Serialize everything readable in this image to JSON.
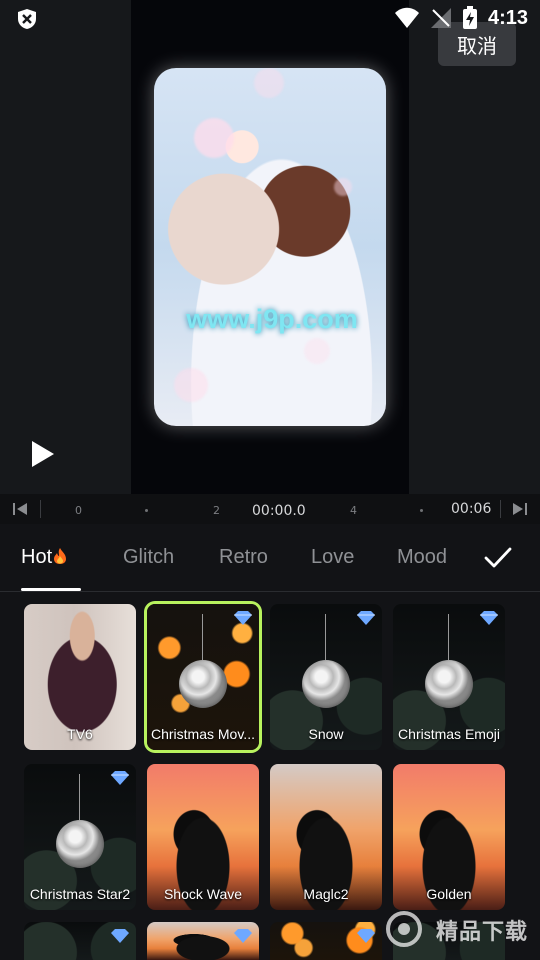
{
  "status": {
    "time": "4:13"
  },
  "preview": {
    "cancel_label": "取消",
    "watermark_text": "www.j9p.com"
  },
  "timeline": {
    "current": "00:00.0",
    "end": "00:06",
    "ticks": [
      "0",
      "2",
      "4"
    ]
  },
  "tabs": [
    {
      "label": "Hot",
      "active": true
    },
    {
      "label": "Glitch",
      "active": false
    },
    {
      "label": "Retro",
      "active": false
    },
    {
      "label": "Love",
      "active": false
    },
    {
      "label": "Mood",
      "active": false
    }
  ],
  "effects": [
    {
      "label": "TV6",
      "premium": false,
      "selected": false
    },
    {
      "label": "Christmas Mov...",
      "premium": true,
      "selected": true
    },
    {
      "label": "Snow",
      "premium": true,
      "selected": false
    },
    {
      "label": "Christmas Emoji",
      "premium": true,
      "selected": false
    },
    {
      "label": "Christmas Star2",
      "premium": true,
      "selected": false
    },
    {
      "label": "Shock Wave",
      "premium": false,
      "selected": false
    },
    {
      "label": "Maglc2",
      "premium": false,
      "selected": false
    },
    {
      "label": "Golden",
      "premium": false,
      "selected": false
    }
  ],
  "colors": {
    "accent": "#b8f25e",
    "gem": "#6ea8ff"
  },
  "watermark_site": "精品下载"
}
